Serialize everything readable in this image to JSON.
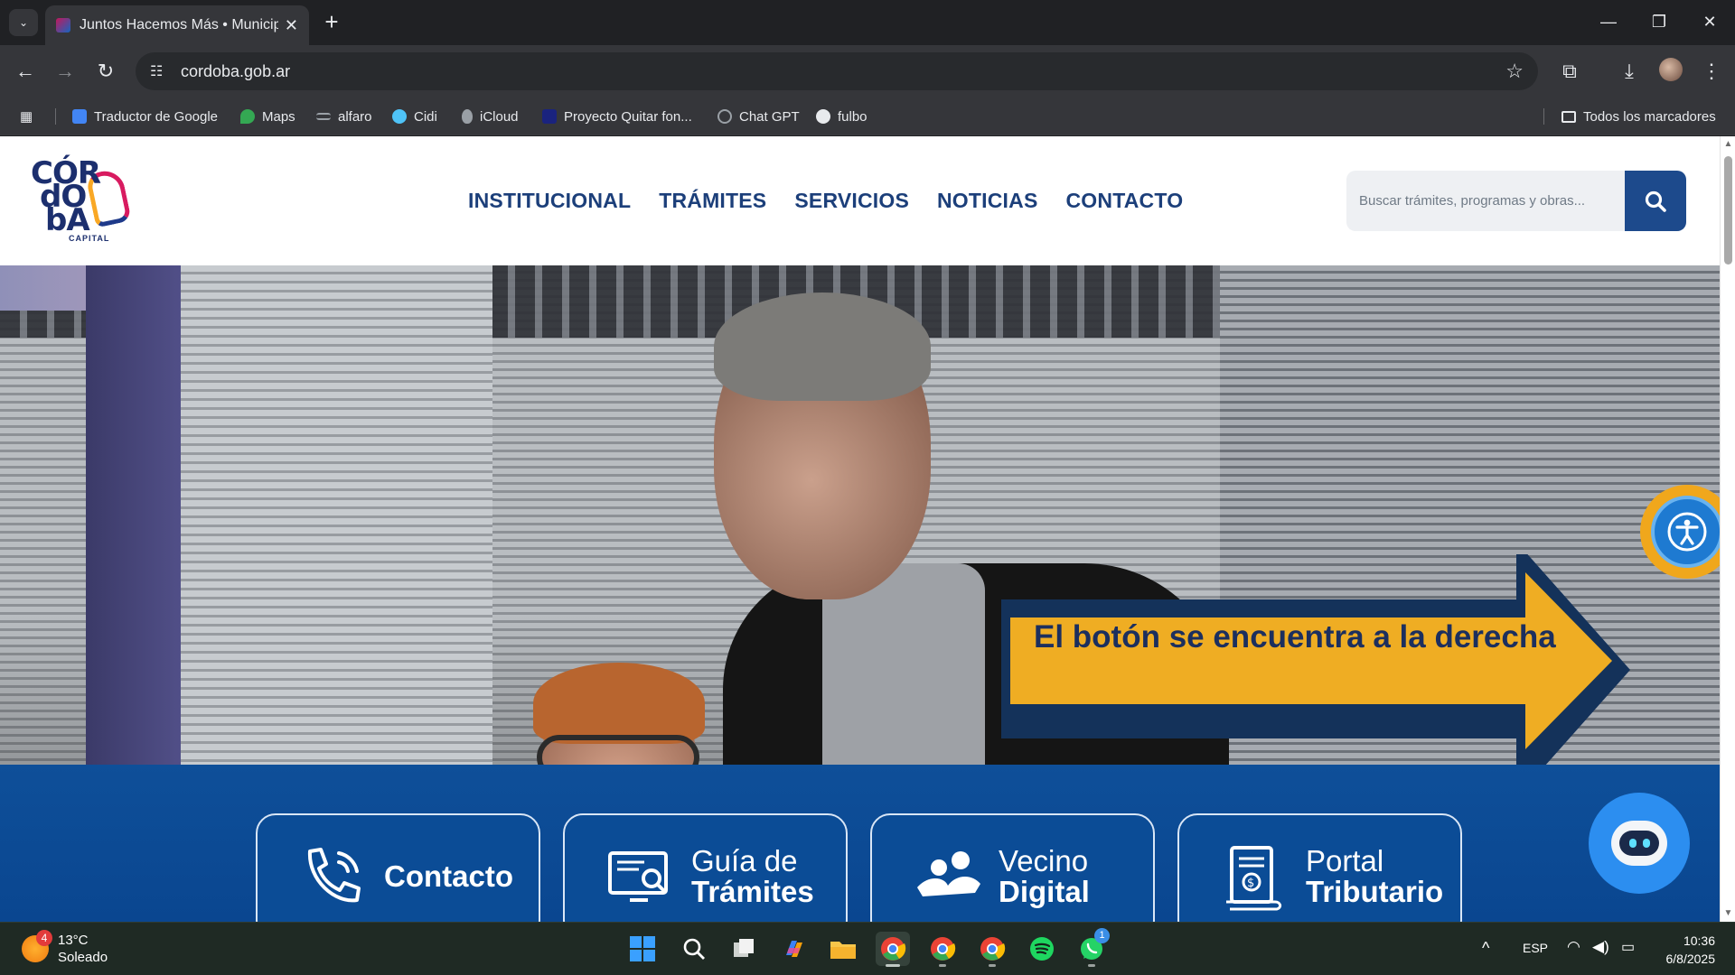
{
  "browser": {
    "tab_title": "Juntos Hacemos Más • Municip",
    "url": "cordoba.gob.ar",
    "bookmarks": [
      {
        "label": "Traductor de Google",
        "color": "#4285f4"
      },
      {
        "label": "Maps",
        "color": "#34a853"
      },
      {
        "label": "alfaro",
        "color": "#9aa0a6"
      },
      {
        "label": "Cidi",
        "color": "#4fc3f7"
      },
      {
        "label": "iCloud",
        "color": "#9aa0a6"
      },
      {
        "label": "Proyecto Quitar fon...",
        "color": "#1a237e"
      },
      {
        "label": "Chat GPT",
        "color": "#9aa0a6"
      },
      {
        "label": "fulbo",
        "color": "#e8eaed"
      }
    ],
    "all_bookmarks_label": "Todos los marcadores"
  },
  "site": {
    "logo_lines": [
      "CÓR",
      "dO",
      "bA"
    ],
    "logo_sub": "CAPITAL",
    "menu": [
      "INSTITUCIONAL",
      "TRÁMITES",
      "SERVICIOS",
      "NOTICIAS",
      "CONTACTO"
    ],
    "search_placeholder": "Buscar trámites, programas y obras...",
    "callout_text": "El botón se encuentra a la derecha",
    "cards": [
      {
        "line1": "Contacto",
        "line2": ""
      },
      {
        "line1": "Guía de",
        "line2": "Trámites"
      },
      {
        "line1": "Vecino",
        "line2": "Digital"
      },
      {
        "line1": "Portal",
        "line2": "Tributario"
      }
    ]
  },
  "taskbar": {
    "weather_temp": "13°C",
    "weather_desc": "Soleado",
    "weather_badge": "4",
    "language": "ESP",
    "time": "10:36",
    "date": "6/8/2025",
    "whatsapp_badge": "1"
  },
  "colors": {
    "nav_blue": "#1c3f7a",
    "services_blue": "#0e4f99",
    "callout_yellow": "#efad23",
    "callout_border": "#14325a",
    "accessibility_blue": "#1e7ad1"
  }
}
